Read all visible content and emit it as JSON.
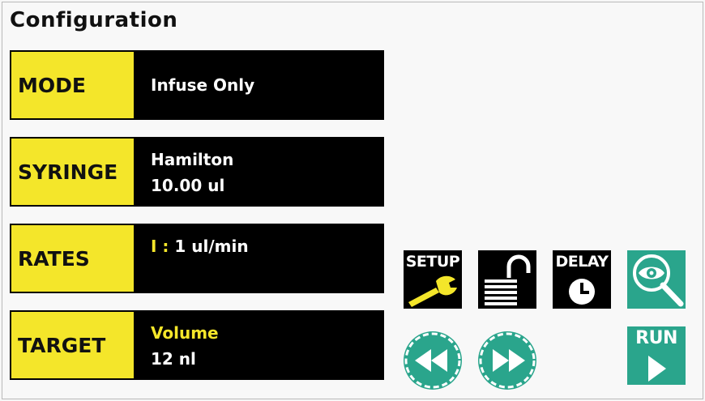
{
  "title": "Configuration",
  "rows": [
    {
      "label": "MODE",
      "value": "Infuse Only"
    },
    {
      "label": "SYRINGE",
      "line1": "Hamilton",
      "line2": "10.00 ul"
    },
    {
      "label": "RATES",
      "prefix": "I",
      "separator": " : ",
      "value": "1 ul/min"
    },
    {
      "label": "TARGET",
      "line1": "Volume",
      "line2": "12 nl"
    }
  ],
  "buttons": {
    "setup": "SETUP",
    "delay": "DELAY",
    "run": "RUN"
  },
  "icons": {
    "setup": "wrench-icon",
    "lock": "unlock-icon",
    "delay": "clock-icon",
    "view": "eye-magnifier-icon",
    "rewind": "rewind-icon",
    "forward": "fast-forward-icon",
    "run": "play-icon"
  },
  "colors": {
    "label_bg": "#f4e62a",
    "panel_bg": "#000000",
    "accent": "#2aa58c",
    "target_text": "#f4e62a"
  }
}
